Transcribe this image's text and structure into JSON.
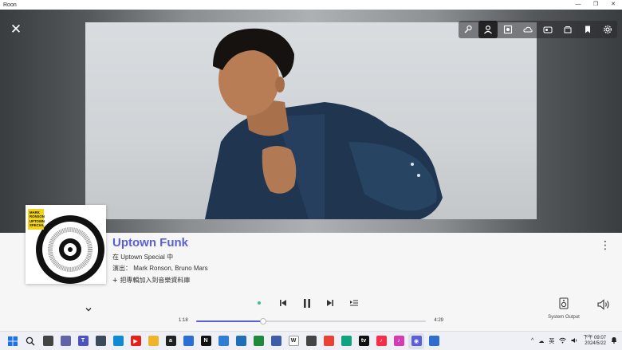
{
  "window": {
    "title": "Roon",
    "controls": [
      "—",
      "❐",
      "✕"
    ]
  },
  "now_playing": {
    "close_label": "✕",
    "toolbar_icons": [
      "microphone-icon",
      "artist-icon",
      "album-view-icon",
      "cloud-icon",
      "radio-icon",
      "stack-icon",
      "bookmark-icon",
      "gear-icon"
    ],
    "active_toolbar_icon": "artist-icon"
  },
  "album_art": {
    "text_lines": [
      "MARK",
      "RONSON",
      "UPTOWN",
      "SPECIAL"
    ],
    "accent_color": "#f2d31a"
  },
  "track": {
    "title": "Uptown Funk",
    "album_prefix": "在",
    "album_name": "Uptown Special",
    "album_suffix": "中",
    "artists_prefix": "演出：",
    "artists": "Mark Ronson, Bruno Mars",
    "add_to_library": "把專輯加入到音樂資料庫"
  },
  "playback": {
    "elapsed": "1:18",
    "total": "4:29",
    "progress": 0.29,
    "output_label": "System Output"
  },
  "taskbar": {
    "apps": [
      {
        "name": "start-icon",
        "color": "#1a73e8",
        "glyph": ""
      },
      {
        "name": "search-icon",
        "color": "#ffffff",
        "glyph": ""
      },
      {
        "name": "task-view-icon",
        "color": "#444444",
        "glyph": ""
      },
      {
        "name": "chat-icon",
        "color": "#6264a7",
        "glyph": ""
      },
      {
        "name": "teams-icon",
        "color": "#4b53bc",
        "glyph": "T"
      },
      {
        "name": "calculator-icon",
        "color": "#3c4b5a",
        "glyph": ""
      },
      {
        "name": "edge-icon",
        "color": "#0f8bd6",
        "glyph": ""
      },
      {
        "name": "youtube-icon",
        "color": "#e62117",
        "glyph": "▶"
      },
      {
        "name": "folder-icon",
        "color": "#f0b429",
        "glyph": ""
      },
      {
        "name": "amazon-icon",
        "color": "#222222",
        "glyph": "a"
      },
      {
        "name": "mail-icon",
        "color": "#2a6fd6",
        "glyph": ""
      },
      {
        "name": "netflix-icon",
        "color": "#111111",
        "glyph": "N"
      },
      {
        "name": "settings-app-icon",
        "color": "#2e7dd7",
        "glyph": ""
      },
      {
        "name": "word-list-icon",
        "color": "#1d6fb8",
        "glyph": ""
      },
      {
        "name": "green-app-icon",
        "color": "#1e8a3c",
        "glyph": ""
      },
      {
        "name": "photos-icon",
        "color": "#3e5da8",
        "glyph": ""
      },
      {
        "name": "wikipedia-icon",
        "color": "#ffffff",
        "glyph": "W"
      },
      {
        "name": "chatgpt-icon",
        "color": "#444444",
        "glyph": ""
      },
      {
        "name": "chrome-icon",
        "color": "#ea4335",
        "glyph": ""
      },
      {
        "name": "maps-icon",
        "color": "#10a37f",
        "glyph": ""
      },
      {
        "name": "appletv-icon",
        "color": "#111111",
        "glyph": "tv"
      },
      {
        "name": "apple-music-icon",
        "color": "#fa2d48",
        "glyph": "♪"
      },
      {
        "name": "itunes-icon",
        "color": "#d63bb5",
        "glyph": "♪"
      },
      {
        "name": "roon-icon",
        "color": "#5b5fd6",
        "glyph": "◉"
      },
      {
        "name": "screen-icon",
        "color": "#2d6ecf",
        "glyph": ""
      }
    ],
    "tray": {
      "chevron": "^",
      "language": "英",
      "time": "下午 09:07",
      "date": "2024/5/22"
    }
  }
}
